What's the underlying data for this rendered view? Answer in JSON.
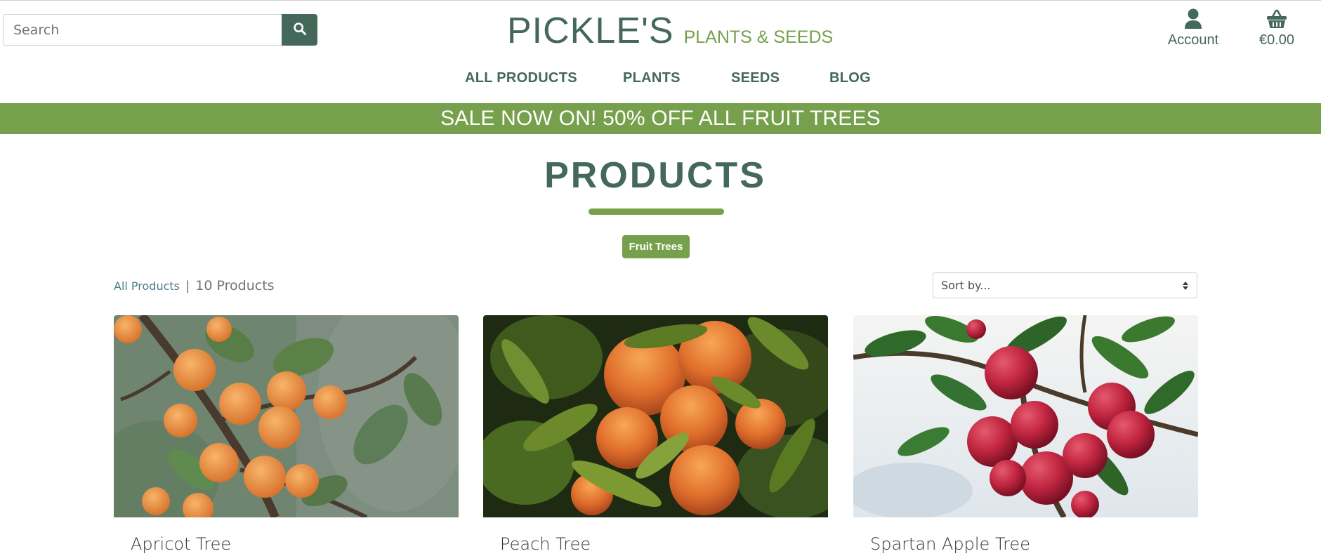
{
  "header": {
    "search": {
      "placeholder": "Search",
      "value": ""
    },
    "brand": {
      "name": "PICKLE'S",
      "tagline": "PLANTS & SEEDS"
    },
    "account_label": "Account",
    "basket_total": "€0.00"
  },
  "nav": {
    "items": [
      {
        "label": "ALL PRODUCTS"
      },
      {
        "label": "PLANTS"
      },
      {
        "label": "SEEDS"
      },
      {
        "label": "BLOG"
      }
    ]
  },
  "banner": {
    "text": "SALE NOW ON! 50% OFF ALL FRUIT TREES"
  },
  "main": {
    "title": "PRODUCTS",
    "category_badge": "Fruit Trees",
    "results": {
      "link_label": "All Products",
      "separator": "|",
      "count_label": "10 Products"
    },
    "sort": {
      "selected": "Sort by..."
    },
    "products": [
      {
        "name": "Apricot Tree"
      },
      {
        "name": "Peach Tree"
      },
      {
        "name": "Spartan Apple Tree"
      }
    ]
  },
  "colors": {
    "brand_dark": "#44685a",
    "brand_green": "#76a04c",
    "link_blue": "#4a7a8c"
  },
  "icons": {
    "search": "search-icon",
    "account": "user-icon",
    "basket": "shopping-basket-icon",
    "sort": "sort-icon"
  }
}
